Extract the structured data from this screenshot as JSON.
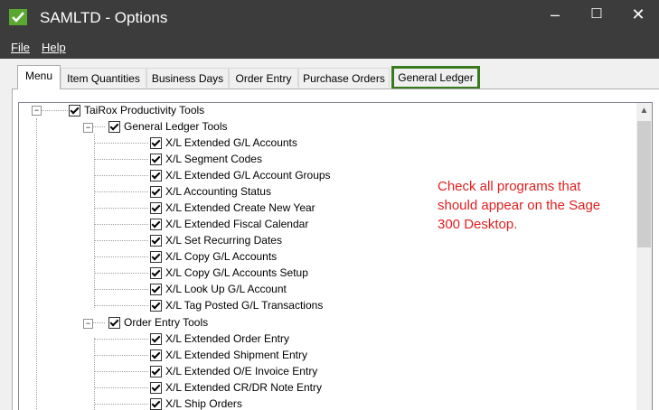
{
  "window": {
    "title": "SAMLTD - Options",
    "minimize_glyph": "–",
    "maximize_glyph": "☐",
    "close_glyph": "✕",
    "app_icon": "sage-check-icon"
  },
  "menu": {
    "file": "File",
    "help": "Help"
  },
  "tabs": [
    {
      "label": "Menu",
      "active": true
    },
    {
      "label": "Item Quantities"
    },
    {
      "label": "Business Days"
    },
    {
      "label": "Order Entry"
    },
    {
      "label": "Purchase Orders"
    },
    {
      "label": "General Ledger",
      "highlighted": true
    }
  ],
  "tree": {
    "root": "TaiRox Productivity Tools",
    "groups": [
      {
        "label": "General Ledger Tools",
        "items": [
          "X/L Extended G/L Accounts",
          "X/L Segment Codes",
          "X/L Extended G/L Account Groups",
          "X/L Accounting Status",
          "X/L Extended Create New Year",
          "X/L Extended Fiscal Calendar",
          "X/L Set Recurring Dates",
          "X/L Copy G/L Accounts",
          "X/L Copy G/L Accounts Setup",
          "X/L Look Up G/L Account",
          "X/L Tag Posted G/L Transactions"
        ]
      },
      {
        "label": "Order Entry Tools",
        "items": [
          "X/L Extended Order Entry",
          "X/L Extended Shipment Entry",
          "X/L Extended O/E Invoice Entry",
          "X/L Extended CR/DR Note Entry",
          "X/L Ship Orders"
        ]
      }
    ]
  },
  "annotation": "Check all programs that should appear on the Sage 300 Desktop.",
  "colors": {
    "titlebar": "#3c3c3c",
    "highlight_border": "#3a7a1f",
    "annotation": "#e02020"
  }
}
